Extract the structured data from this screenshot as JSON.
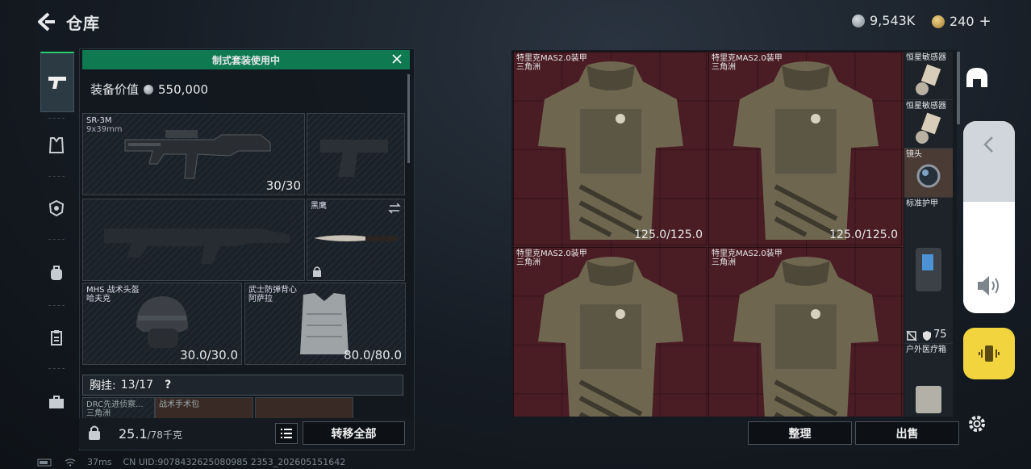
{
  "header": {
    "title": "仓库",
    "currency_1": "9,543K",
    "currency_2": "240",
    "add_symbol": "+"
  },
  "left_panel": {
    "banner": "制式套装使用中",
    "equipment_value_label": "装备价值",
    "equipment_value": "550,000",
    "primary_weapon": {
      "name": "SR-3M",
      "caliber": "9x39mm",
      "ammo": "30/30"
    },
    "melee": {
      "name": "黑鹰"
    },
    "helmet": {
      "name": "MHS 战术头盔",
      "origin": "哈夫克",
      "durability": "30.0/30.0"
    },
    "armor": {
      "name": "武士防弹背心",
      "origin": "阿萨拉",
      "durability": "80.0/80.0"
    },
    "rig_label": "胸挂:",
    "rig_value": "13/17",
    "rig_help": "?",
    "partial_items": [
      "DRC先进侦察...",
      "三角洲",
      "战术手术包"
    ],
    "weight": "25.1",
    "weight_max": "/78千克",
    "transfer_all": "转移全部"
  },
  "grid": {
    "vests": [
      {
        "name": "特里克MAS2.0装甲",
        "origin": "三角洲",
        "durability": "125.0/125.0"
      },
      {
        "name": "特里克MAS2.0装甲",
        "origin": "三角洲",
        "durability": "125.0/125.0"
      },
      {
        "name": "特里克MAS2.0装甲",
        "origin": "三角洲",
        "durability": ""
      },
      {
        "name": "特里克MAS2.0装甲",
        "origin": "三角洲",
        "durability": ""
      }
    ],
    "side_items": [
      {
        "label": "恒星敏感器"
      },
      {
        "label": "恒星敏感器"
      },
      {
        "label": "镜头"
      },
      {
        "label": "标准护甲"
      },
      {
        "label": "户外医疗箱"
      }
    ],
    "armor_value": "75",
    "organize": "整理",
    "sell": "出售"
  },
  "status_bar": {
    "ping": "37ms",
    "uid": "CN UID:9078432625080985 2353_202605151642"
  },
  "colors": {
    "banner_green": "#0f7a52",
    "grid_red": "#4a1c24",
    "vibrate_yellow": "#f2d43e"
  }
}
